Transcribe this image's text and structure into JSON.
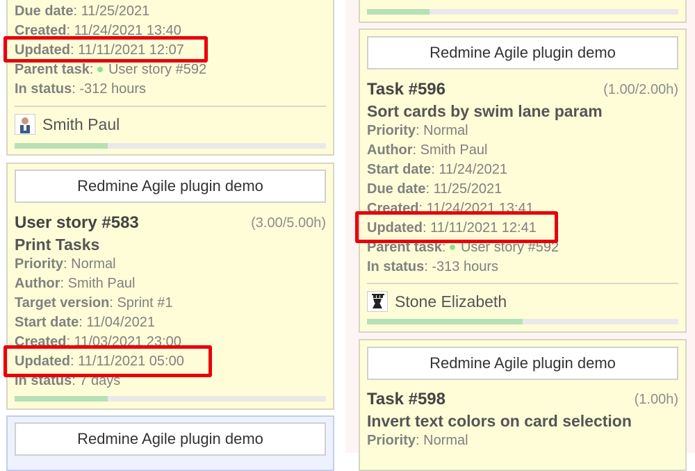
{
  "labels": {
    "priority": "Priority",
    "author": "Author",
    "target_version": "Target version",
    "start_date": "Start date",
    "due_date": "Due date",
    "created": "Created",
    "updated": "Updated",
    "parent_task": "Parent task",
    "in_status": "In status"
  },
  "left": {
    "card_top": {
      "due_date": "11/25/2021",
      "created": "11/24/2021 13:40",
      "updated": "11/11/2021 12:07",
      "parent_task": "User story #592",
      "in_status": "-312 hours",
      "assignee": "Smith Paul",
      "progress": 0.3
    },
    "card_583": {
      "project": "Redmine Agile plugin demo",
      "title": "User story #583",
      "hours": "(3.00/5.00h)",
      "subject": "Print Tasks",
      "priority": "Normal",
      "author": "Smith Paul",
      "target_version": "Sprint #1",
      "start_date": "11/04/2021",
      "created": "11/03/2021 23:00",
      "updated": "11/11/2021 05:00",
      "in_status": "7 days",
      "progress": 0.3
    },
    "card_bottom": {
      "project": "Redmine Agile plugin demo"
    }
  },
  "right": {
    "card_top": {
      "progress": 0.2
    },
    "card_596": {
      "project": "Redmine Agile plugin demo",
      "title": "Task #596",
      "hours": "(1.00/2.00h)",
      "subject": "Sort cards by swim lane param",
      "priority": "Normal",
      "author": "Smith Paul",
      "start_date": "11/24/2021",
      "due_date": "11/25/2021",
      "created": "11/24/2021 13:41",
      "updated": "11/11/2021 12:41",
      "parent_task": "User story #592",
      "in_status": "-313 hours",
      "assignee": "Stone Elizabeth",
      "progress": 0.5
    },
    "card_598": {
      "project": "Redmine Agile plugin demo",
      "title": "Task #598",
      "hours": "(1.00h)",
      "subject": "Invert text colors on card selection",
      "priority": "Normal"
    }
  },
  "colors": {
    "card_bg": "#fffdd8",
    "highlight": "#e8000b",
    "progress_fill": "#b6e0b6"
  }
}
